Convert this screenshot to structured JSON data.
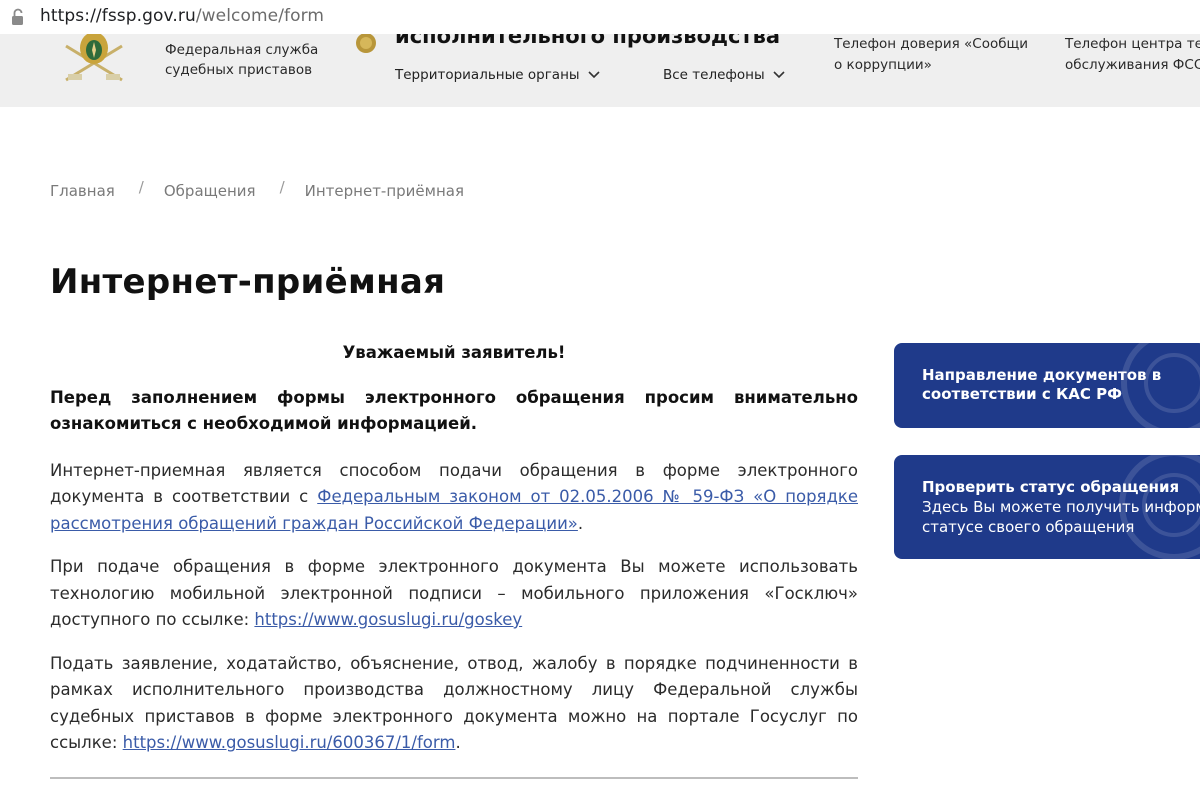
{
  "browser": {
    "url_host": "https://fssp.gov.ru",
    "url_path": "/welcome/form"
  },
  "header": {
    "org_line1": "Федеральная служба",
    "org_line2": "судебных приставов",
    "title": "исполнительного производства",
    "nav_territorial": "Территориальные органы",
    "nav_phones": "Все телефоны",
    "phone1_line1": "Телефон доверия «Сообщи",
    "phone1_line2": "о коррупции»",
    "phone2_line1": "Телефон центра тел",
    "phone2_line2": "обслуживания ФСС"
  },
  "breadcrumb": {
    "items": [
      "Главная",
      "Обращения",
      "Интернет-приёмная"
    ],
    "separator": "/"
  },
  "page": {
    "title": "Интернет-приёмная"
  },
  "content": {
    "greeting": "Уважаемый заявитель!",
    "intro_bold": "Перед заполнением формы электронного обращения просим внимательно ознакомиться с необходимой информацией.",
    "p1_before": "Интернет-приемная является способом подачи обращения в форме электронного документа в соответствии с ",
    "p1_link": "Федеральным законом от 02.05.2006 № 59-ФЗ «О порядке рассмотрения обращений граждан Российской Федерации»",
    "p1_after": ".",
    "p2_before": "При подаче обращения в форме электронного документа Вы можете использовать технологию мобильной электронной подписи – мобильного приложения «Госключ» доступного по ссылке: ",
    "p2_link": "https://www.gosuslugi.ru/goskey",
    "p3_before": "Подать заявление, ходатайство, объяснение, отвод, жалобу в порядке подчиненности в рамках исполнительного производства должностному лицу Федеральной службы судебных приставов в форме электронного документа можно на портале Госуслуг по ссылке: ",
    "p3_link": "https://www.gosuslugi.ru/600367/1/form",
    "p3_after": "."
  },
  "sidebar": {
    "card1_line1": "Направление документов в",
    "card1_line2": "соответствии с КАС РФ",
    "card2_title": "Проверить статус обращения",
    "card2_sub1": "Здесь Вы можете получить информа",
    "card2_sub2": "статусе своего обращения"
  },
  "colors": {
    "card_bg": "#1f3a8a",
    "link": "#3a5ba8",
    "header_bg": "#efefef"
  },
  "icons": [
    "lock-icon",
    "fssp-emblem-icon",
    "medal-icon",
    "chevron-down-icon"
  ]
}
